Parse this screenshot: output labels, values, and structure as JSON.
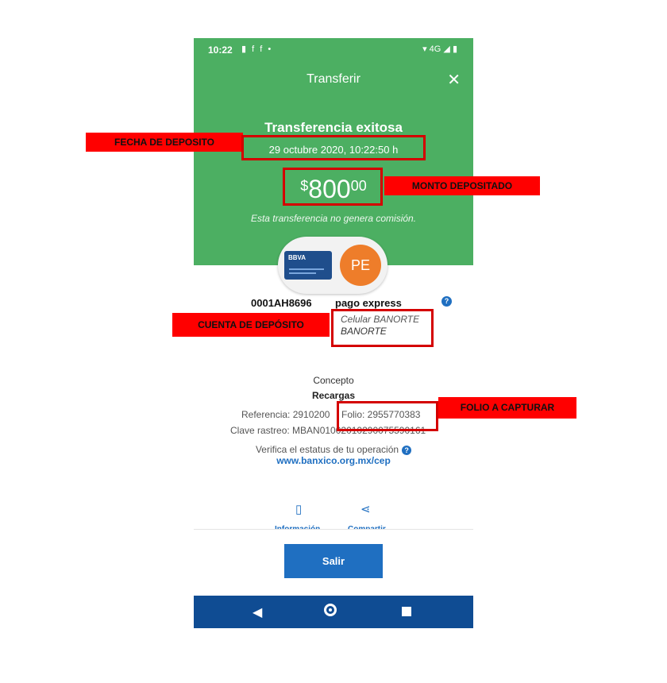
{
  "status_bar": {
    "time": "10:22",
    "icons": "▮ f f •",
    "network": "4G"
  },
  "header": {
    "title": "Transferir",
    "close": "✕"
  },
  "success": {
    "title": "Transferencia exitosa",
    "date": "29 octubre 2020, 10:22:50 h",
    "amount": {
      "currency": "$",
      "integer": "800",
      "decimals": "00"
    },
    "commission_note": "Esta transferencia no genera comisión."
  },
  "origin_card": {
    "brand": "BBVA"
  },
  "payee_avatar": "PE",
  "account": {
    "number": "0001AH8696",
    "payee": "pago express",
    "help": "?"
  },
  "bank": {
    "line1": "Celular BANORTE",
    "line2": "BANORTE"
  },
  "concept": {
    "label": "Concepto",
    "value": "Recargas"
  },
  "details": {
    "referencia": "Referencia: 2910200",
    "folio": "Folio: 2955770383",
    "clave_rastreo": "Clave rastreo: MBAN01002010290075590161"
  },
  "verify": {
    "text": "Verifica el estatus de tu operación",
    "help": "?",
    "link": "www.banxico.org.mx/cep"
  },
  "actions": {
    "info": "Información",
    "share": "Compartir"
  },
  "exit_button": "Salir",
  "annotations": {
    "fecha": "FECHA DE DEPOSITO",
    "monto": "MONTO DEPOSITADO",
    "cuenta": "CUENTA DE DEPÓSITO",
    "folio": "FOLIO A CAPTURAR"
  },
  "colors": {
    "green": "#4caf62",
    "blue": "#1f6fc1",
    "nav": "#0f4c93",
    "annotation_red": "#ff0000"
  }
}
